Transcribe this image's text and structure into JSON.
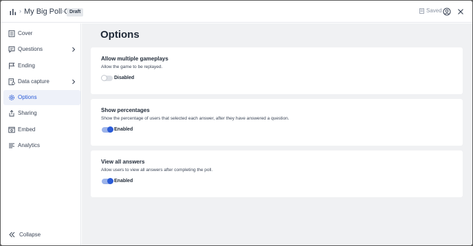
{
  "header": {
    "breadcrumb_sep": "›",
    "title": "My Big Poll Card",
    "badge": "Draft",
    "saved": "Saved",
    "icons": {
      "app": "bar-chart-icon",
      "saved": "save-icon",
      "account": "user-circle-icon",
      "close": "close-icon"
    }
  },
  "sidebar": {
    "items": [
      {
        "label": "Cover",
        "icon": "document-icon",
        "chevron": false,
        "active": false
      },
      {
        "label": "Questions",
        "icon": "chat-icon",
        "chevron": true,
        "active": false
      },
      {
        "label": "Ending",
        "icon": "flag-icon",
        "chevron": false,
        "active": false
      },
      {
        "label": "Data capture",
        "icon": "data-capture-icon",
        "chevron": true,
        "active": false
      },
      {
        "label": "Options",
        "icon": "gear-icon",
        "chevron": false,
        "active": true
      },
      {
        "label": "Sharing",
        "icon": "share-icon",
        "chevron": false,
        "active": false
      },
      {
        "label": "Embed",
        "icon": "embed-icon",
        "chevron": false,
        "active": false
      },
      {
        "label": "Analytics",
        "icon": "analytics-icon",
        "chevron": false,
        "active": false
      }
    ],
    "collapse_label": "Collapse"
  },
  "main": {
    "title": "Options",
    "cards": [
      {
        "title": "Allow multiple gameplays",
        "description": "Allow the game to be replayed.",
        "enabled": false,
        "state_label": "Disabled"
      },
      {
        "title": "Show percentages",
        "description": "Show the percentage of users that selected each answer, after they have answered a question.",
        "enabled": true,
        "state_label": "Enabled"
      },
      {
        "title": "View all answers",
        "description": "Allow users to view all answers after completing the poll.",
        "enabled": true,
        "state_label": "Enabled"
      }
    ]
  },
  "colors": {
    "accent": "#2a5bd7",
    "background": "#f0f1f3"
  }
}
